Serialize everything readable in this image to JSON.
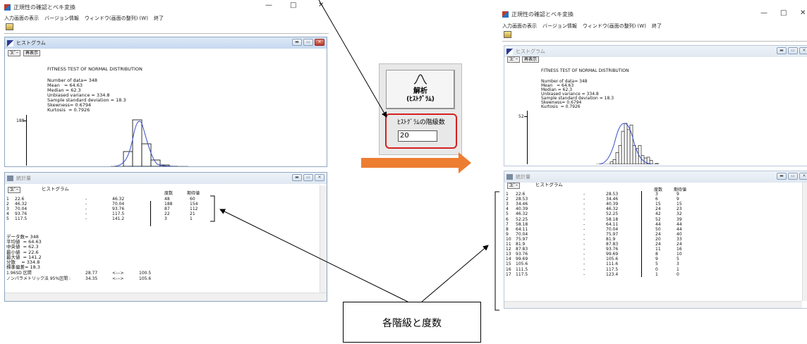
{
  "left_app": {
    "title": "正規性の確認とベキ変換",
    "menu": [
      "入力画面の表示",
      "バージョン情報",
      "ウィンドウ(画面の整列) (W)",
      "終了"
    ],
    "win_controls": [
      "—",
      "□",
      "✕"
    ],
    "histogram_window": {
      "title": "ヒストグラム",
      "buttons": [
        "ｺﾋﾟｰ",
        "再表示"
      ],
      "heading": "FITNESS TEST OF NORMAL DISTRIBUTION",
      "stats": [
        "Number of data= 348",
        "Mean   = 64.63",
        "Median = 62.3",
        "Unbiased variance = 334.8",
        "Sample standard deviation = 18.3",
        "Skewness= 0.6794",
        "Kurtosis  = 0.7926"
      ],
      "y_tick": "188"
    },
    "stats_window": {
      "title": "統計量",
      "copy_button": "ｺﾋﾟｰ",
      "section_title": "ヒストグラム",
      "col_headers": [
        "度数",
        "期待値"
      ],
      "rows": [
        {
          "n": "1",
          "from": "22.6",
          "to": "46.32",
          "freq": "48",
          "exp": "60"
        },
        {
          "n": "2",
          "from": "46.32",
          "to": "70.04",
          "freq": "188",
          "exp": "154"
        },
        {
          "n": "3",
          "from": "70.04",
          "to": "93.76",
          "freq": "87",
          "exp": "112"
        },
        {
          "n": "4",
          "from": "93.76",
          "to": "117.5",
          "freq": "22",
          "exp": "21"
        },
        {
          "n": "5",
          "from": "117.5",
          "to": "141.2",
          "freq": "3",
          "exp": "1"
        }
      ],
      "summary": [
        "データ数= 348",
        "平均値  = 64.63",
        "中央値  = 62.3",
        "最小値  = 22.6",
        "最大値  = 141.2",
        "分散    = 334.8",
        "標準偏差= 18.3"
      ],
      "sd_line": {
        "label": "1.96SD 区間",
        "low": "28.77",
        "arrow": "<--->",
        "high": "100.5"
      },
      "np_line": {
        "label": "ノンパラメトリック法 95%区間 :",
        "low": "34.35",
        "arrow": "<--->",
        "high": "105.6"
      }
    }
  },
  "middle_panel": {
    "button_label_1": "解析",
    "button_label_2": "(ﾋｽﾄｸﾞﾗﾑ)",
    "bins_label": "ﾋｽﾄｸﾞﾗﾑの階級数",
    "bins_value": "20"
  },
  "right_app": {
    "title": "正規性の確認とベキ変換",
    "menu": [
      "入力画面の表示",
      "バージョン情報",
      "ウィンドウ(画面の整列) (W)",
      "終了"
    ],
    "win_controls": [
      "—",
      "□",
      "✕"
    ],
    "histogram_window": {
      "title": "ヒストグラム",
      "buttons": [
        "ｺﾋﾟｰ",
        "再表示"
      ],
      "heading": "FITNESS TEST OF NORMAL DISTRIBUTION",
      "stats": [
        "Number of data= 348",
        "Mean   = 64.63",
        "Median = 62.3",
        "Unbiased variance = 334.8",
        "Sample standard deviation = 18.3",
        "Skewness= 0.6794",
        "Kurtosis  = 0.7926"
      ],
      "y_tick": "52"
    },
    "stats_window": {
      "title": "統計量",
      "copy_button": "ｺﾋﾟｰ",
      "section_title": "ヒストグラム",
      "col_headers": [
        "度数",
        "期待値"
      ],
      "rows": [
        {
          "n": "1",
          "from": "22.6",
          "to": "28.53",
          "freq": "3",
          "exp": "9"
        },
        {
          "n": "2",
          "from": "28.53",
          "to": "34.46",
          "freq": "6",
          "exp": "9"
        },
        {
          "n": "3",
          "from": "34.46",
          "to": "40.39",
          "freq": "15",
          "exp": "15"
        },
        {
          "n": "4",
          "from": "40.39",
          "to": "46.32",
          "freq": "24",
          "exp": "23"
        },
        {
          "n": "5",
          "from": "46.32",
          "to": "52.25",
          "freq": "42",
          "exp": "32"
        },
        {
          "n": "6",
          "from": "52.25",
          "to": "58.18",
          "freq": "52",
          "exp": "39"
        },
        {
          "n": "7",
          "from": "58.18",
          "to": "64.11",
          "freq": "44",
          "exp": "44"
        },
        {
          "n": "8",
          "from": "64.11",
          "to": "70.04",
          "freq": "50",
          "exp": "44"
        },
        {
          "n": "9",
          "from": "70.04",
          "to": "75.97",
          "freq": "24",
          "exp": "40"
        },
        {
          "n": "10",
          "from": "75.97",
          "to": "81.9",
          "freq": "20",
          "exp": "33"
        },
        {
          "n": "11",
          "from": "81.9",
          "to": "87.83",
          "freq": "24",
          "exp": "24"
        },
        {
          "n": "12",
          "from": "87.83",
          "to": "93.76",
          "freq": "11",
          "exp": "16"
        },
        {
          "n": "13",
          "from": "93.76",
          "to": "99.69",
          "freq": "8",
          "exp": "10"
        },
        {
          "n": "14",
          "from": "99.69",
          "to": "105.6",
          "freq": "9",
          "exp": "5"
        },
        {
          "n": "15",
          "from": "105.6",
          "to": "111.6",
          "freq": "5",
          "exp": "3"
        },
        {
          "n": "16",
          "from": "111.5",
          "to": "117.5",
          "freq": "0",
          "exp": "1"
        },
        {
          "n": "17",
          "from": "117.5",
          "to": "123.4",
          "freq": "1",
          "exp": "0"
        }
      ]
    }
  },
  "callout": {
    "text": "各階級と度数"
  },
  "colors": {
    "highlight_border": "#d62020",
    "arrow_fill": "#ed7d31",
    "curve": "#3a4fc9"
  }
}
